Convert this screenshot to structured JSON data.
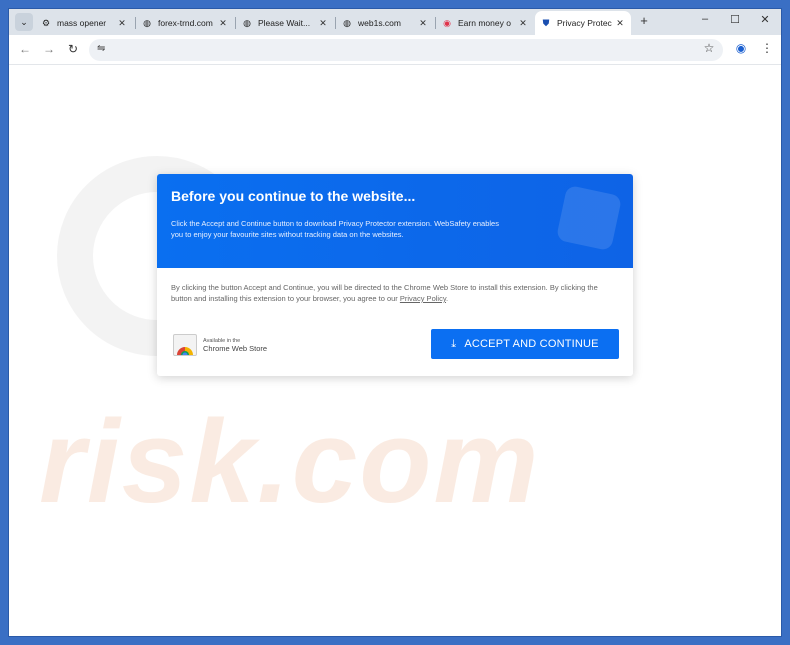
{
  "tabs": [
    {
      "label": "mass opener",
      "icon": "globe-gear-icon"
    },
    {
      "label": "forex-trnd.com",
      "icon": "globe-icon"
    },
    {
      "label": "Please Wait...",
      "icon": "globe-icon"
    },
    {
      "label": "web1s.com",
      "icon": "globe-icon"
    },
    {
      "label": "Earn money o",
      "icon": "red-circle-icon"
    },
    {
      "label": "Privacy Protec",
      "icon": "shield-icon",
      "active": true
    }
  ],
  "window": {
    "minimize": "–",
    "maximize": "☐",
    "close": "✕",
    "new_tab": "+"
  },
  "toolbar": {
    "back": "←",
    "forward": "→",
    "reload": "↻",
    "site_info": "⇋",
    "bookmark": "☆",
    "profile": "◉",
    "menu": "⋮",
    "url": ""
  },
  "watermark": {
    "text": "risk.com"
  },
  "dialog": {
    "title": "Before you continue to the website...",
    "subtitle": "Click the Accept and Continue button to download Privacy Protector extension. WebSafety enables you to enjoy your favourite sites without tracking data on the websites.",
    "body_text": "By clicking the button Accept and Continue, you will be directed to the Chrome Web Store to install this extension. By clicking the button and installing this extension to your browser, you agree to our ",
    "policy_link": "Privacy Policy",
    "body_end": ".",
    "badge_small": "Available in the",
    "badge_large": "Chrome Web Store",
    "button_label": "ACCEPT AND CONTINUE"
  },
  "colors": {
    "accent": "#0b6ff2",
    "header": "#0a6ff0",
    "tabstrip": "#dde3ea"
  }
}
